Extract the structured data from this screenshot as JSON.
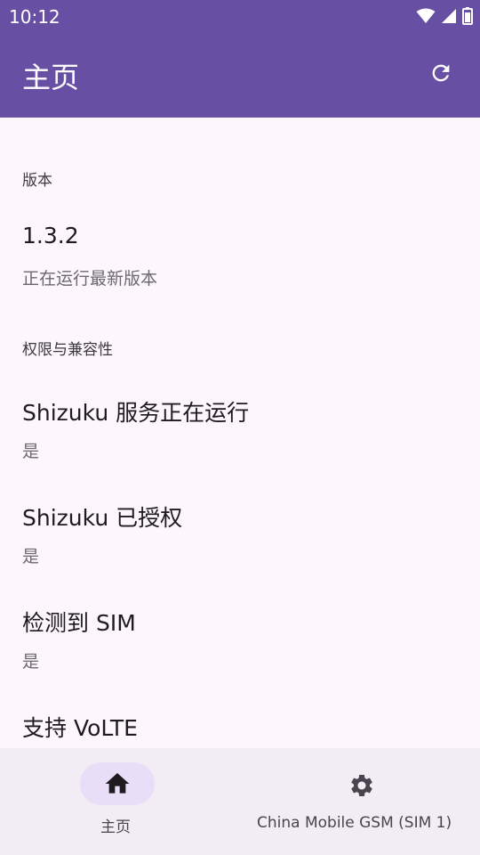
{
  "status_bar": {
    "time": "10:12",
    "icons": [
      "wifi-icon",
      "cellular-signal-icon",
      "battery-icon"
    ]
  },
  "app_bar": {
    "title": "主页",
    "action_icon": "refresh-icon",
    "color": "#6750a4"
  },
  "sections": {
    "version": {
      "header": "版本",
      "items": [
        {
          "title": "1.3.2",
          "subtitle": "正在运行最新版本"
        }
      ]
    },
    "permissions": {
      "header": "权限与兼容性",
      "items": [
        {
          "title": "Shizuku 服务正在运行",
          "subtitle": "是"
        },
        {
          "title": "Shizuku 已授权",
          "subtitle": "是"
        },
        {
          "title": "检测到 SIM",
          "subtitle": "是"
        },
        {
          "title": "支持 VoLTE",
          "subtitle": ""
        }
      ]
    }
  },
  "bottom_nav": {
    "items": [
      {
        "label": "主页",
        "icon": "home-icon",
        "selected": true
      },
      {
        "label": "China Mobile GSM (SIM 1)",
        "icon": "gear-icon",
        "selected": false
      }
    ],
    "pill_color": "#e8def8"
  }
}
